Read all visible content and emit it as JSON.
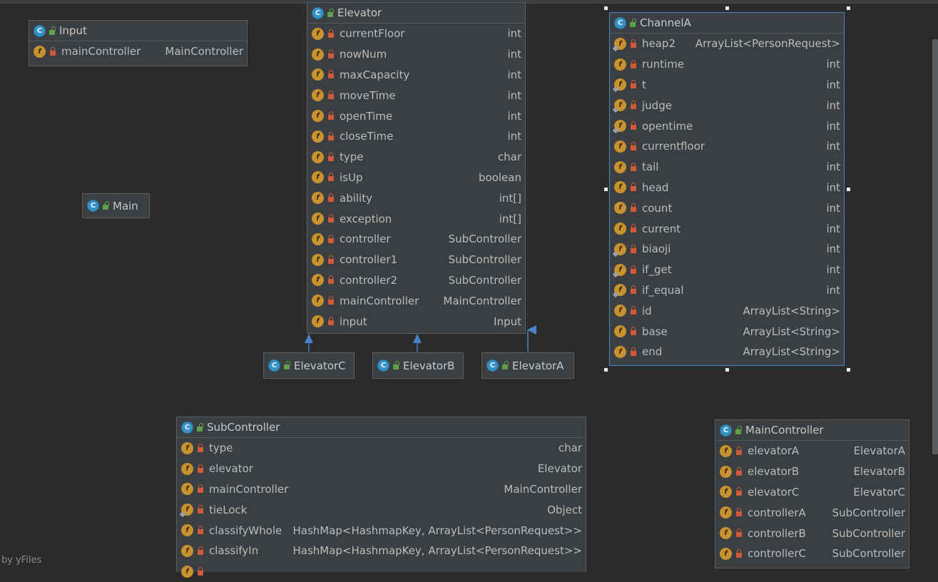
{
  "watermark": "by yFiles",
  "colors": {
    "background": "#2b2b2b",
    "node": "#3c3f41",
    "selection": "#4b83c8",
    "arrow": "#4b83c8",
    "class_icon": "#3592c4",
    "field_icon": "#c7922f"
  },
  "icons": {
    "class": "C",
    "field": "f"
  },
  "nodes": {
    "input": {
      "title": "Input",
      "fields": [
        {
          "name": "mainController",
          "type": "MainController"
        }
      ]
    },
    "main": {
      "title": "Main"
    },
    "elevator": {
      "title": "Elevator",
      "fields": [
        {
          "name": "currentFloor",
          "type": "int"
        },
        {
          "name": "nowNum",
          "type": "int"
        },
        {
          "name": "maxCapacity",
          "type": "int"
        },
        {
          "name": "moveTime",
          "type": "int"
        },
        {
          "name": "openTime",
          "type": "int"
        },
        {
          "name": "closeTime",
          "type": "int"
        },
        {
          "name": "type",
          "type": "char"
        },
        {
          "name": "isUp",
          "type": "boolean"
        },
        {
          "name": "ability",
          "type": "int[]"
        },
        {
          "name": "exception",
          "type": "int[]"
        },
        {
          "name": "controller",
          "type": "SubController"
        },
        {
          "name": "controller1",
          "type": "SubController"
        },
        {
          "name": "controller2",
          "type": "SubController"
        },
        {
          "name": "mainController",
          "type": "MainController"
        },
        {
          "name": "input",
          "type": "Input"
        }
      ]
    },
    "elevatorC": {
      "title": "ElevatorC"
    },
    "elevatorB": {
      "title": "ElevatorB"
    },
    "elevatorA": {
      "title": "ElevatorA"
    },
    "channelA": {
      "title": "ChannelA",
      "fields": [
        {
          "name": "heap2",
          "type": "ArrayList<PersonRequest>"
        },
        {
          "name": "runtime",
          "type": "int"
        },
        {
          "name": "t",
          "type": "int"
        },
        {
          "name": "judge",
          "type": "int"
        },
        {
          "name": "opentime",
          "type": "int"
        },
        {
          "name": "currentfloor",
          "type": "int"
        },
        {
          "name": "tail",
          "type": "int"
        },
        {
          "name": "head",
          "type": "int"
        },
        {
          "name": "count",
          "type": "int"
        },
        {
          "name": "current",
          "type": "int"
        },
        {
          "name": "biaoji",
          "type": "int"
        },
        {
          "name": "if_get",
          "type": "int"
        },
        {
          "name": "if_equal",
          "type": "int"
        },
        {
          "name": "id",
          "type": "ArrayList<String>"
        },
        {
          "name": "base",
          "type": "ArrayList<String>"
        },
        {
          "name": "end",
          "type": "ArrayList<String>"
        }
      ]
    },
    "subController": {
      "title": "SubController",
      "fields": [
        {
          "name": "type",
          "type": "char"
        },
        {
          "name": "elevator",
          "type": "Elevator"
        },
        {
          "name": "mainController",
          "type": "MainController"
        },
        {
          "name": "tieLock",
          "type": "Object"
        },
        {
          "name": "classifyWhole",
          "type": "HashMap<HashmapKey, ArrayList<PersonRequest>>"
        },
        {
          "name": "classifyIn",
          "type": "HashMap<HashmapKey, ArrayList<PersonRequest>>"
        },
        {
          "name": "",
          "type": ""
        }
      ]
    },
    "mainController": {
      "title": "MainController",
      "fields": [
        {
          "name": "elevatorA",
          "type": "ElevatorA"
        },
        {
          "name": "elevatorB",
          "type": "ElevatorB"
        },
        {
          "name": "elevatorC",
          "type": "ElevatorC"
        },
        {
          "name": "controllerA",
          "type": "SubController"
        },
        {
          "name": "controllerB",
          "type": "SubController"
        },
        {
          "name": "controllerC",
          "type": "SubController"
        }
      ]
    }
  }
}
